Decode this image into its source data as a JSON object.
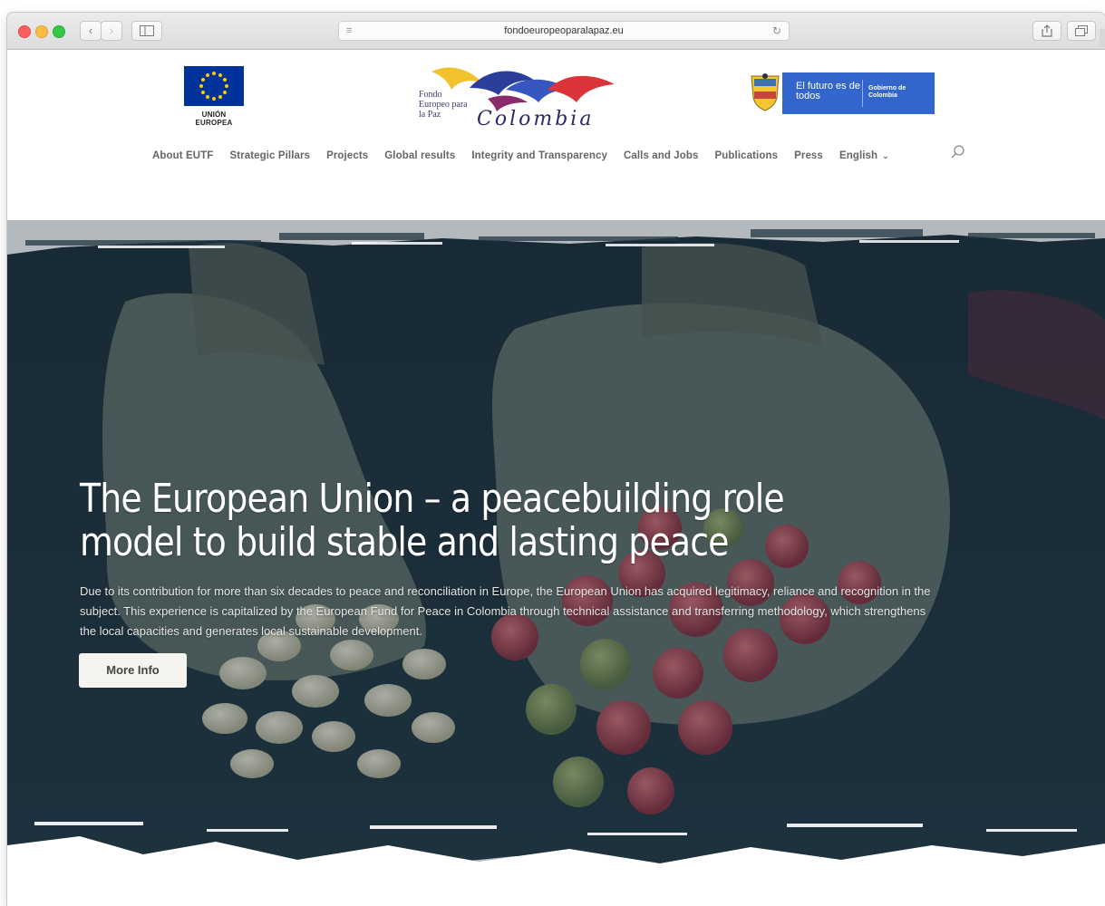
{
  "browser": {
    "url": "fondoeuropeoparalapaz.eu",
    "reader_icon": "reader-icon",
    "reload_icon": "reload-icon",
    "back_icon": "chevron-left-icon",
    "forward_icon": "chevron-right-icon",
    "sidebar_icon": "sidebar-icon",
    "share_icon": "share-icon",
    "tabs_icon": "tabs-icon"
  },
  "header": {
    "eu_logo_label": "UNIÓN EUROPEA",
    "fondo_logo_text": "Fondo Europeo para la Paz",
    "fondo_logo_script": "Colombia",
    "gov_logo_line1": "El futuro es de todos",
    "gov_logo_line2": "Gobierno de Colombia"
  },
  "nav": {
    "items": [
      {
        "label": "About EUTF"
      },
      {
        "label": "Strategic Pillars"
      },
      {
        "label": "Projects"
      },
      {
        "label": "Global results"
      },
      {
        "label": "Integrity and Transparency"
      },
      {
        "label": "Calls and Jobs"
      },
      {
        "label": "Publications"
      },
      {
        "label": "Press"
      }
    ],
    "language": "English",
    "search_icon": "search-icon"
  },
  "hero": {
    "title": "The European Union – a peacebuilding role model to build stable and lasting peace",
    "text": "Due to its contribution for more than six decades to peace and reconciliation in Europe, the European Union has acquired legitimacy, reliance and recognition in the subject. This experience is capitalized by the European Fund for Peace in Colombia through technical assistance and transferring methodology, which strengthens the local capacities and generates local sustainable development.",
    "button_label": "More Info"
  },
  "colors": {
    "hero_overlay": "#1c2f3a",
    "eu_blue": "#003399",
    "gov_blue": "#3366cc",
    "nav_text": "#666666"
  }
}
